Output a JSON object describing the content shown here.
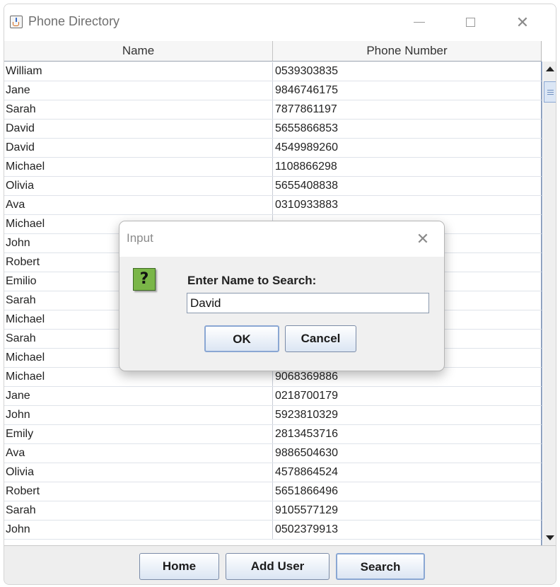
{
  "window": {
    "title": "Phone Directory"
  },
  "table": {
    "columns": [
      "Name",
      "Phone Number"
    ],
    "rows": [
      [
        "William",
        "0539303835"
      ],
      [
        "Jane",
        "9846746175"
      ],
      [
        "Sarah",
        "7877861197"
      ],
      [
        "David",
        "5655866853"
      ],
      [
        "David",
        "4549989260"
      ],
      [
        "Michael",
        "1108866298"
      ],
      [
        "Olivia",
        "5655408838"
      ],
      [
        "Ava",
        "0310933883"
      ],
      [
        "Michael",
        ""
      ],
      [
        "John",
        ""
      ],
      [
        "Robert",
        ""
      ],
      [
        "Emilio",
        ""
      ],
      [
        "Sarah",
        ""
      ],
      [
        "Michael",
        ""
      ],
      [
        "Sarah",
        ""
      ],
      [
        "Michael",
        ""
      ],
      [
        "Michael",
        "9068369886"
      ],
      [
        "Jane",
        "0218700179"
      ],
      [
        "John",
        "5923810329"
      ],
      [
        "Emily",
        "2813453716"
      ],
      [
        "Ava",
        "9886504630"
      ],
      [
        "Olivia",
        "4578864524"
      ],
      [
        "Robert",
        "5651866496"
      ],
      [
        "Sarah",
        "9105577129"
      ],
      [
        "John",
        "0502379913"
      ]
    ]
  },
  "buttons": {
    "home": "Home",
    "add_user": "Add User",
    "search": "Search"
  },
  "dialog": {
    "title": "Input",
    "prompt": "Enter Name to Search:",
    "input_value": "David",
    "icon_glyph": "?",
    "ok": "OK",
    "cancel": "Cancel"
  }
}
